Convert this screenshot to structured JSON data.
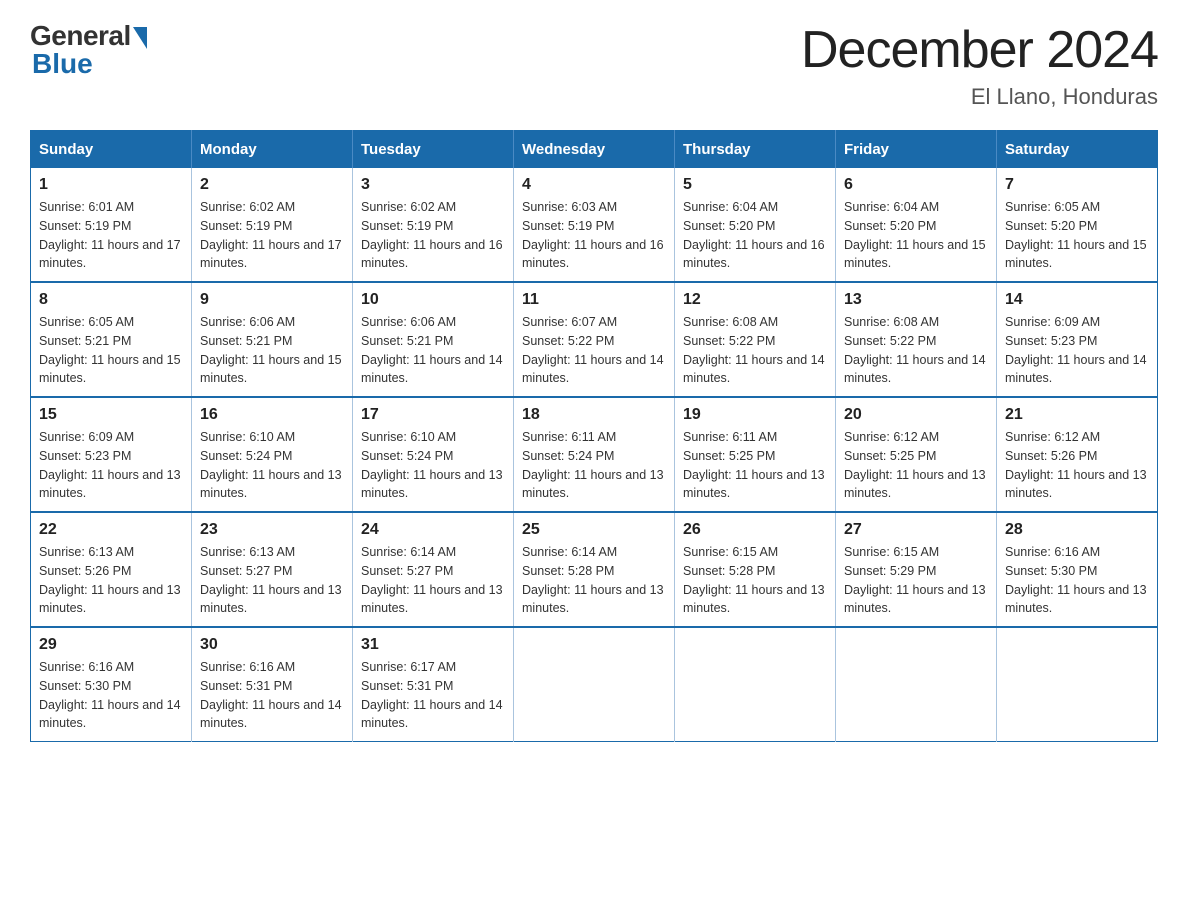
{
  "logo": {
    "general": "General",
    "blue": "Blue"
  },
  "header": {
    "month_year": "December 2024",
    "location": "El Llano, Honduras"
  },
  "days_of_week": [
    "Sunday",
    "Monday",
    "Tuesday",
    "Wednesday",
    "Thursday",
    "Friday",
    "Saturday"
  ],
  "weeks": [
    [
      {
        "day": "1",
        "sunrise": "6:01 AM",
        "sunset": "5:19 PM",
        "daylight": "11 hours and 17 minutes."
      },
      {
        "day": "2",
        "sunrise": "6:02 AM",
        "sunset": "5:19 PM",
        "daylight": "11 hours and 17 minutes."
      },
      {
        "day": "3",
        "sunrise": "6:02 AM",
        "sunset": "5:19 PM",
        "daylight": "11 hours and 16 minutes."
      },
      {
        "day": "4",
        "sunrise": "6:03 AM",
        "sunset": "5:19 PM",
        "daylight": "11 hours and 16 minutes."
      },
      {
        "day": "5",
        "sunrise": "6:04 AM",
        "sunset": "5:20 PM",
        "daylight": "11 hours and 16 minutes."
      },
      {
        "day": "6",
        "sunrise": "6:04 AM",
        "sunset": "5:20 PM",
        "daylight": "11 hours and 15 minutes."
      },
      {
        "day": "7",
        "sunrise": "6:05 AM",
        "sunset": "5:20 PM",
        "daylight": "11 hours and 15 minutes."
      }
    ],
    [
      {
        "day": "8",
        "sunrise": "6:05 AM",
        "sunset": "5:21 PM",
        "daylight": "11 hours and 15 minutes."
      },
      {
        "day": "9",
        "sunrise": "6:06 AM",
        "sunset": "5:21 PM",
        "daylight": "11 hours and 15 minutes."
      },
      {
        "day": "10",
        "sunrise": "6:06 AM",
        "sunset": "5:21 PM",
        "daylight": "11 hours and 14 minutes."
      },
      {
        "day": "11",
        "sunrise": "6:07 AM",
        "sunset": "5:22 PM",
        "daylight": "11 hours and 14 minutes."
      },
      {
        "day": "12",
        "sunrise": "6:08 AM",
        "sunset": "5:22 PM",
        "daylight": "11 hours and 14 minutes."
      },
      {
        "day": "13",
        "sunrise": "6:08 AM",
        "sunset": "5:22 PM",
        "daylight": "11 hours and 14 minutes."
      },
      {
        "day": "14",
        "sunrise": "6:09 AM",
        "sunset": "5:23 PM",
        "daylight": "11 hours and 14 minutes."
      }
    ],
    [
      {
        "day": "15",
        "sunrise": "6:09 AM",
        "sunset": "5:23 PM",
        "daylight": "11 hours and 13 minutes."
      },
      {
        "day": "16",
        "sunrise": "6:10 AM",
        "sunset": "5:24 PM",
        "daylight": "11 hours and 13 minutes."
      },
      {
        "day": "17",
        "sunrise": "6:10 AM",
        "sunset": "5:24 PM",
        "daylight": "11 hours and 13 minutes."
      },
      {
        "day": "18",
        "sunrise": "6:11 AM",
        "sunset": "5:24 PM",
        "daylight": "11 hours and 13 minutes."
      },
      {
        "day": "19",
        "sunrise": "6:11 AM",
        "sunset": "5:25 PM",
        "daylight": "11 hours and 13 minutes."
      },
      {
        "day": "20",
        "sunrise": "6:12 AM",
        "sunset": "5:25 PM",
        "daylight": "11 hours and 13 minutes."
      },
      {
        "day": "21",
        "sunrise": "6:12 AM",
        "sunset": "5:26 PM",
        "daylight": "11 hours and 13 minutes."
      }
    ],
    [
      {
        "day": "22",
        "sunrise": "6:13 AM",
        "sunset": "5:26 PM",
        "daylight": "11 hours and 13 minutes."
      },
      {
        "day": "23",
        "sunrise": "6:13 AM",
        "sunset": "5:27 PM",
        "daylight": "11 hours and 13 minutes."
      },
      {
        "day": "24",
        "sunrise": "6:14 AM",
        "sunset": "5:27 PM",
        "daylight": "11 hours and 13 minutes."
      },
      {
        "day": "25",
        "sunrise": "6:14 AM",
        "sunset": "5:28 PM",
        "daylight": "11 hours and 13 minutes."
      },
      {
        "day": "26",
        "sunrise": "6:15 AM",
        "sunset": "5:28 PM",
        "daylight": "11 hours and 13 minutes."
      },
      {
        "day": "27",
        "sunrise": "6:15 AM",
        "sunset": "5:29 PM",
        "daylight": "11 hours and 13 minutes."
      },
      {
        "day": "28",
        "sunrise": "6:16 AM",
        "sunset": "5:30 PM",
        "daylight": "11 hours and 13 minutes."
      }
    ],
    [
      {
        "day": "29",
        "sunrise": "6:16 AM",
        "sunset": "5:30 PM",
        "daylight": "11 hours and 14 minutes."
      },
      {
        "day": "30",
        "sunrise": "6:16 AM",
        "sunset": "5:31 PM",
        "daylight": "11 hours and 14 minutes."
      },
      {
        "day": "31",
        "sunrise": "6:17 AM",
        "sunset": "5:31 PM",
        "daylight": "11 hours and 14 minutes."
      },
      null,
      null,
      null,
      null
    ]
  ]
}
